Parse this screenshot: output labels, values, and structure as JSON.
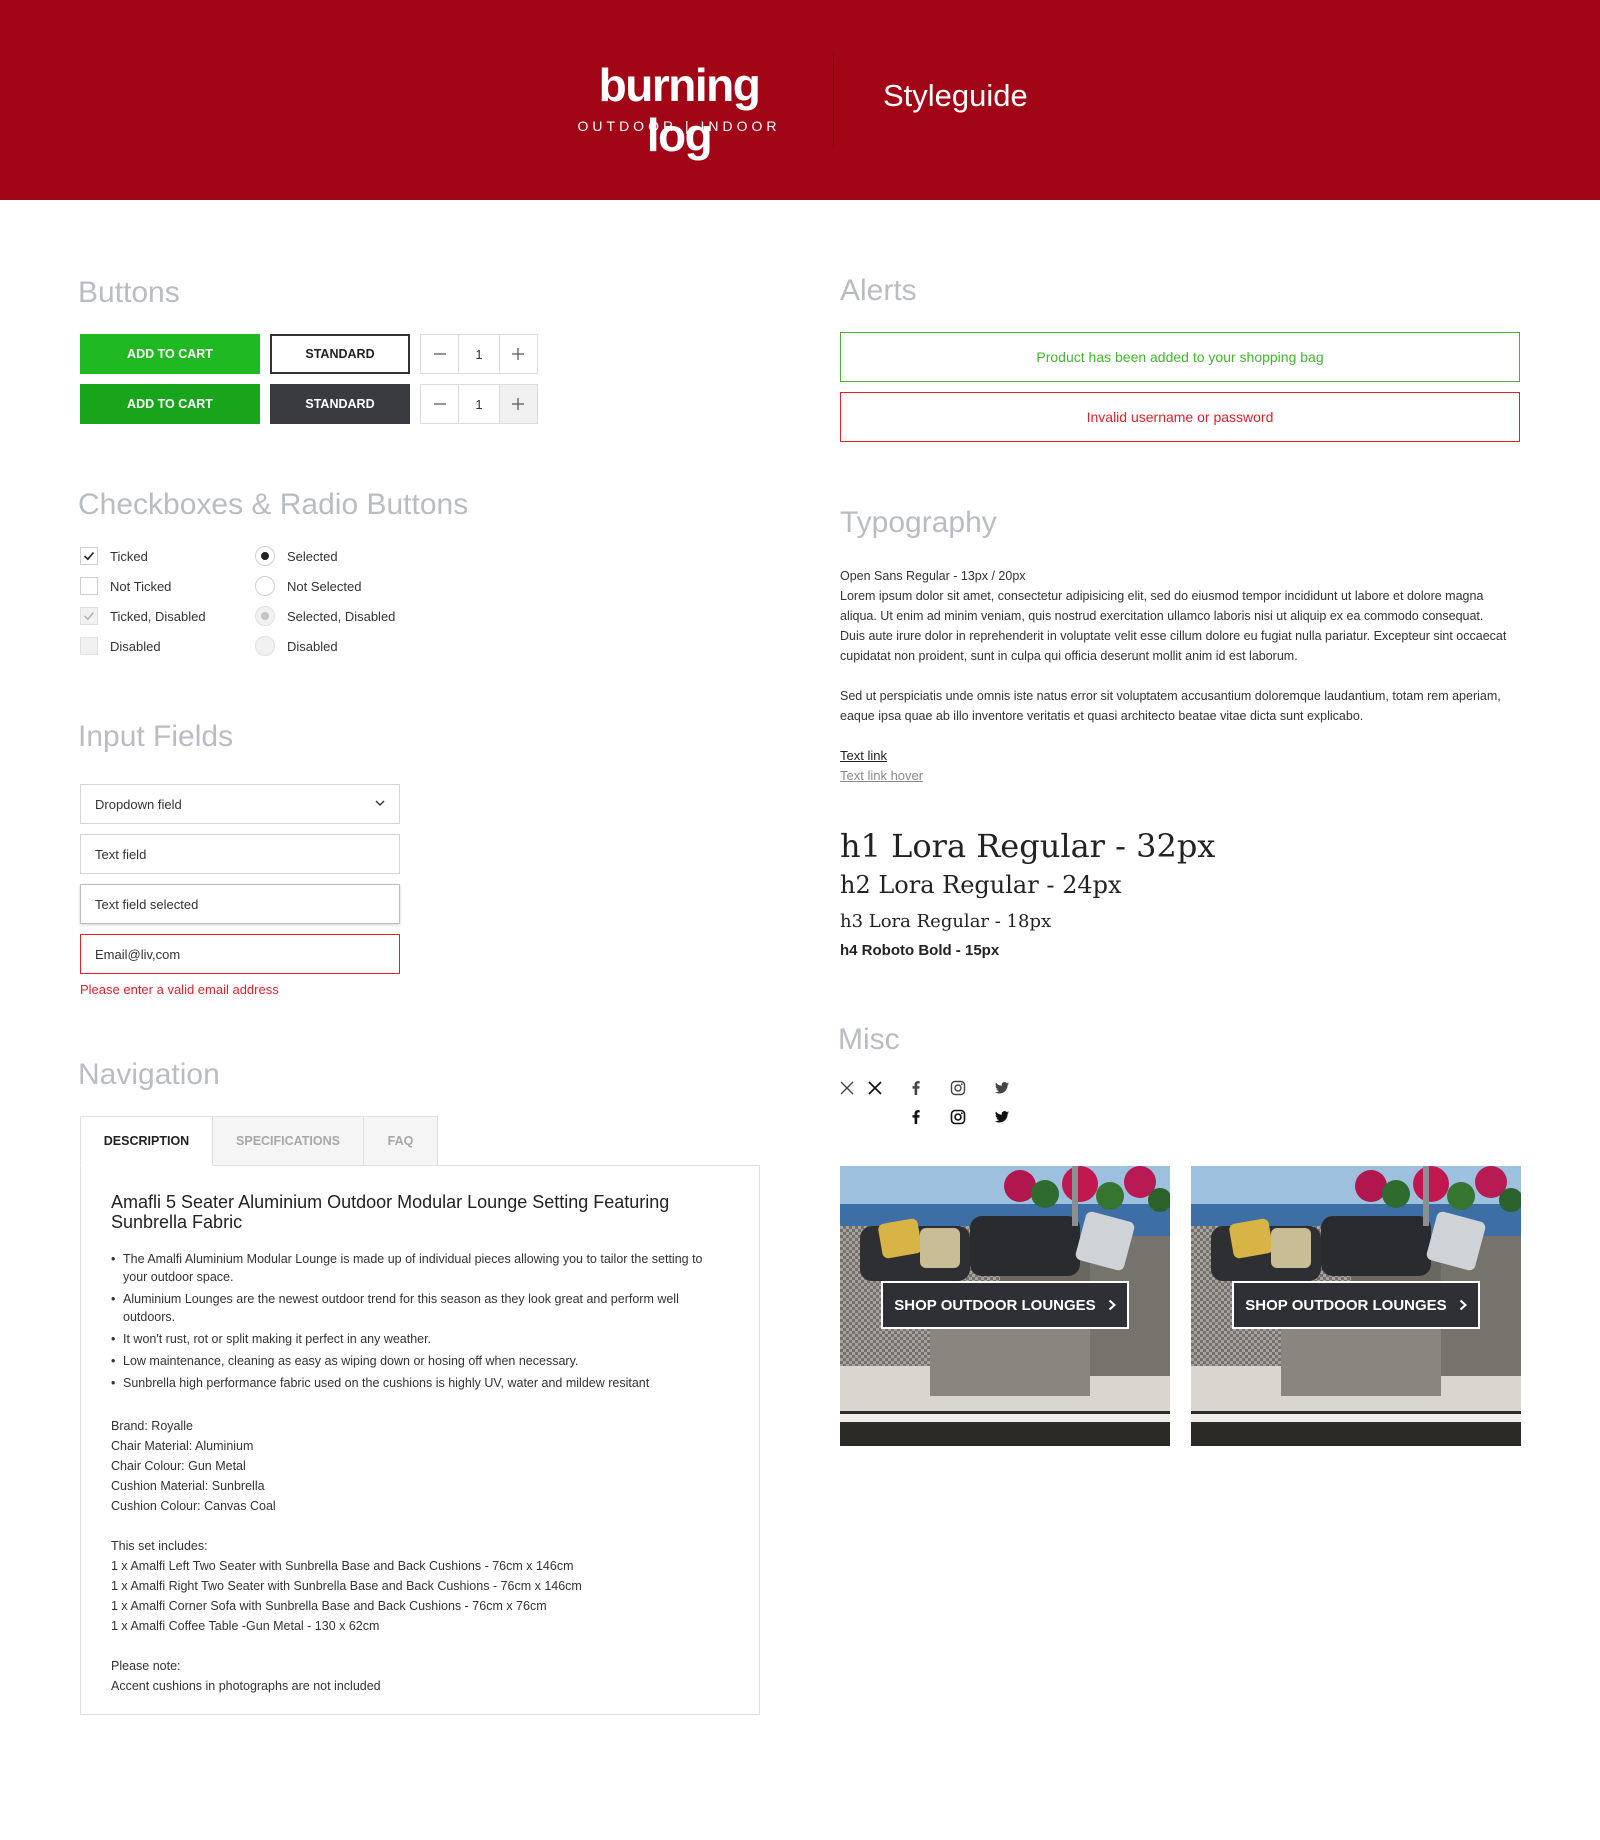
{
  "header": {
    "logo_main": "burning log",
    "logo_sub": "OUTDOOR | INDOOR",
    "title": "Styleguide",
    "background_color": "#a10516"
  },
  "buttons": {
    "title": "Buttons",
    "add_to_cart": "ADD TO CART",
    "standard": "STANDARD",
    "stepper_value": "1",
    "stepper_minus_icon": "minus-icon",
    "stepper_plus_icon": "plus-icon",
    "cart_color": "#1fba22",
    "dark_color": "#3a3b40"
  },
  "checks": {
    "title": "Checkboxes & Radio Buttons",
    "checkboxes": [
      "Ticked",
      "Not Ticked",
      "Ticked, Disabled",
      "Disabled"
    ],
    "radios": [
      "Selected",
      "Not Selected",
      "Selected, Disabled",
      "Disabled"
    ]
  },
  "inputs": {
    "title": "Input Fields",
    "dropdown": "Dropdown field",
    "text_field": "Text field",
    "text_field_selected": "Text field selected",
    "email_value": "Email@liv,com",
    "error_message": "Please enter a valid email address",
    "error_color": "#e0202a"
  },
  "navigation": {
    "title": "Navigation",
    "tabs": [
      "DESCRIPTION",
      "SPECIFICATIONS",
      "FAQ"
    ],
    "panel_title": "Amafli 5 Seater  Aluminium Outdoor Modular Lounge Setting Featuring Sunbrella Fabric",
    "bullets": [
      "The Amalfi Aluminium Modular Lounge is made up of individual pieces allowing you to tailor the setting to your outdoor space.",
      "Aluminium Lounges are the newest outdoor trend for this season as they look great and perform well outdoors.",
      "It won't rust, rot or split making it perfect in any weather.",
      "Low maintenance, cleaning as easy as wiping down or hosing off when necessary.",
      "Sunbrella high performance fabric used on the cushions is highly UV, water and mildew resitant"
    ],
    "specs": [
      "Brand: Royalle",
      "Chair Material: Aluminium",
      "Chair Colour: Gun Metal",
      "Cushion Material: Sunbrella",
      "Cushion Colour: Canvas Coal"
    ],
    "includes": [
      "This set includes:",
      "1 x Amalfi Left  Two Seater with Sunbrella Base and Back Cushions - 76cm x 146cm",
      "1 x Amalfi Right Two Seater with Sunbrella Base and Back Cushions -  76cm x 146cm",
      "1 x Amalfi Corner Sofa with Sunbrella Base and Back Cushions -  76cm x 76cm",
      "1 x Amalfi Coffee Table -Gun Metal - 130 x 62cm"
    ],
    "note": [
      "Please note:",
      "Accent cushions in photographs are not included"
    ]
  },
  "alerts": {
    "title": "Alerts",
    "success": "Product has been added to your shopping bag",
    "error": "Invalid username or password",
    "success_color": "#43b62d",
    "error_color": "#e0202a"
  },
  "typography": {
    "title": "Typography",
    "font_spec": "Open Sans Regular - 13px / 20px",
    "paragraph1": [
      "Lorem ipsum dolor sit amet, consectetur adipisicing elit, sed do eiusmod tempor incididunt ut labore et dolore magna",
      "aliqua. Ut enim ad minim veniam, quis nostrud exercitation ullamco laboris nisi ut aliquip ex ea commodo consequat.",
      "Duis aute irure dolor in reprehenderit in voluptate velit esse cillum dolore eu fugiat nulla pariatur. Excepteur sint occaecat",
      "cupidatat non proident, sunt in culpa qui officia deserunt mollit anim id est laborum."
    ],
    "paragraph2": [
      "Sed ut perspiciatis unde omnis iste natus error sit voluptatem accusantium doloremque laudantium, totam rem aperiam,",
      "eaque ipsa quae ab illo inventore veritatis et quasi architecto beatae vitae dicta sunt explicabo."
    ],
    "text_link": "Text link",
    "text_link_hover": "Text link hover",
    "h1": "h1 Lora Regular - 32px",
    "h2": "h2 Lora Regular - 24px",
    "h3": "h3 Lora Regular - 18px",
    "h4": "h4 Roboto Bold - 15px"
  },
  "misc": {
    "title": "Misc",
    "icons_row1": [
      "close-icon",
      "close-icon",
      "facebook-icon",
      "instagram-icon",
      "twitter-icon"
    ],
    "icons_row2": [
      "facebook-icon",
      "instagram-icon",
      "twitter-icon"
    ],
    "banner_label": "SHOP OUTDOOR LOUNGES",
    "banner_arrow_icon": "chevron-right-icon"
  }
}
